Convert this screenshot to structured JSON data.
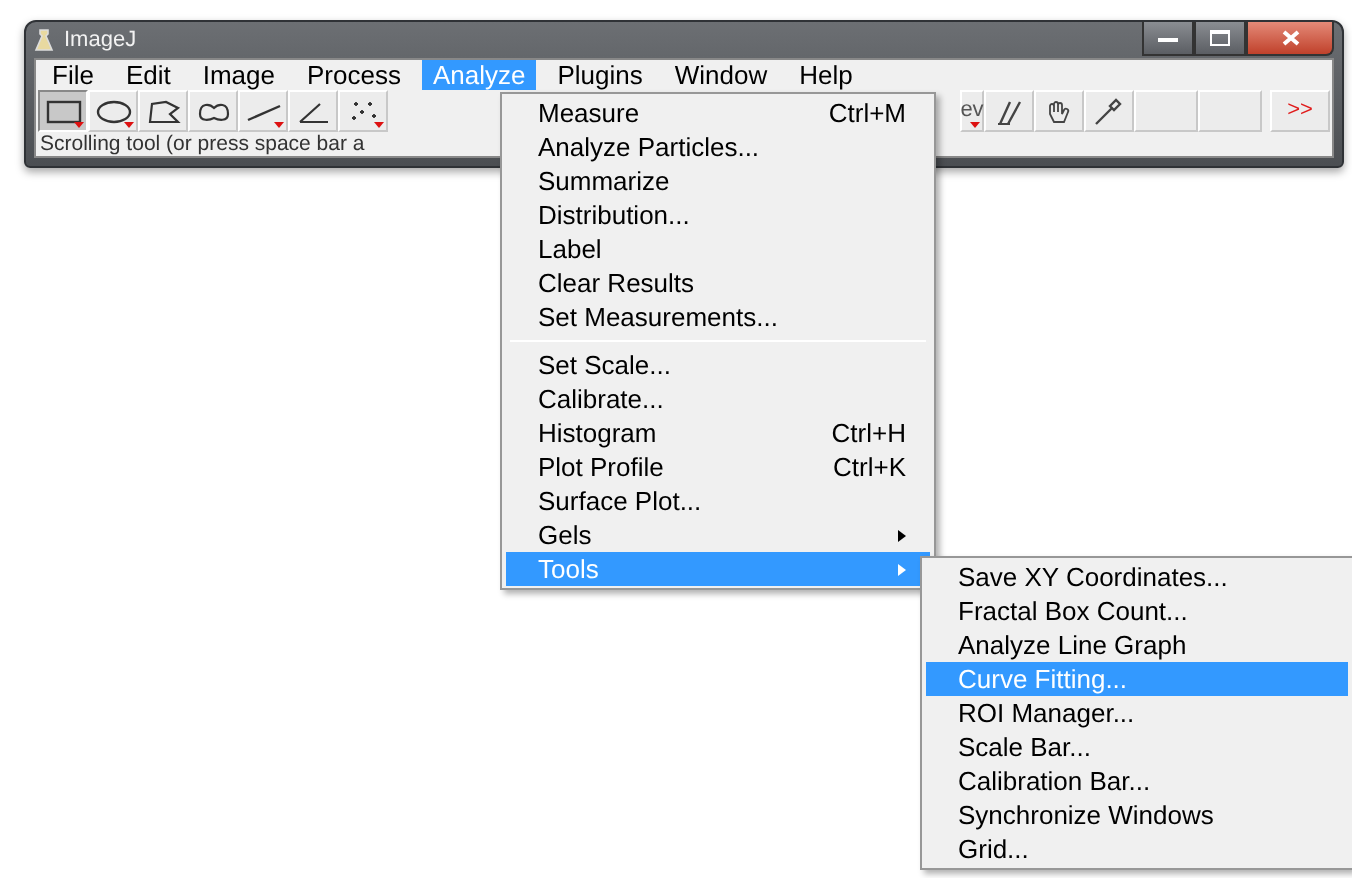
{
  "window": {
    "title": "ImageJ"
  },
  "menu_bar": [
    {
      "label": "File",
      "selected": false
    },
    {
      "label": "Edit",
      "selected": false
    },
    {
      "label": "Image",
      "selected": false
    },
    {
      "label": "Process",
      "selected": false
    },
    {
      "label": "Analyze",
      "selected": true
    },
    {
      "label": "Plugins",
      "selected": false
    },
    {
      "label": "Window",
      "selected": false
    },
    {
      "label": "Help",
      "selected": false
    }
  ],
  "toolbar": [
    {
      "kind": "rectangle",
      "selected": true,
      "has_menu": true
    },
    {
      "kind": "oval",
      "selected": false,
      "has_menu": true
    },
    {
      "kind": "polygon",
      "selected": false,
      "has_menu": false
    },
    {
      "kind": "freehand",
      "selected": false,
      "has_menu": false
    },
    {
      "kind": "line",
      "selected": false,
      "has_menu": true
    },
    {
      "kind": "angle",
      "selected": false,
      "has_menu": false
    },
    {
      "kind": "points",
      "selected": false,
      "has_menu": true
    },
    {
      "kind": "gap"
    },
    {
      "kind": "text",
      "label": "ev",
      "selected": false,
      "has_menu": true
    },
    {
      "kind": "brush",
      "selected": false,
      "has_menu": false
    },
    {
      "kind": "hand",
      "selected": false,
      "has_menu": false
    },
    {
      "kind": "dropper",
      "selected": false,
      "has_menu": false
    },
    {
      "kind": "empty",
      "selected": false,
      "has_menu": false
    },
    {
      "kind": "empty",
      "selected": false,
      "has_menu": false
    },
    {
      "kind": "more",
      "label": ">>",
      "selected": false,
      "has_menu": false
    }
  ],
  "status_text": "Scrolling tool (or press space bar a",
  "analyze_menu": [
    {
      "kind": "item",
      "label": "Measure",
      "shortcut": "Ctrl+M",
      "submenu": false,
      "selected": false
    },
    {
      "kind": "item",
      "label": "Analyze Particles...",
      "submenu": false,
      "selected": false
    },
    {
      "kind": "item",
      "label": "Summarize",
      "submenu": false,
      "selected": false
    },
    {
      "kind": "item",
      "label": "Distribution...",
      "submenu": false,
      "selected": false
    },
    {
      "kind": "item",
      "label": "Label",
      "submenu": false,
      "selected": false
    },
    {
      "kind": "item",
      "label": "Clear Results",
      "submenu": false,
      "selected": false
    },
    {
      "kind": "item",
      "label": "Set Measurements...",
      "submenu": false,
      "selected": false
    },
    {
      "kind": "separator"
    },
    {
      "kind": "item",
      "label": "Set Scale...",
      "submenu": false,
      "selected": false
    },
    {
      "kind": "item",
      "label": "Calibrate...",
      "submenu": false,
      "selected": false
    },
    {
      "kind": "item",
      "label": "Histogram",
      "shortcut": "Ctrl+H",
      "submenu": false,
      "selected": false
    },
    {
      "kind": "item",
      "label": "Plot Profile",
      "shortcut": "Ctrl+K",
      "submenu": false,
      "selected": false
    },
    {
      "kind": "item",
      "label": "Surface Plot...",
      "submenu": false,
      "selected": false
    },
    {
      "kind": "item",
      "label": "Gels",
      "submenu": true,
      "selected": false
    },
    {
      "kind": "item",
      "label": "Tools",
      "submenu": true,
      "selected": true
    }
  ],
  "tools_submenu": [
    {
      "kind": "item",
      "label": "Save XY Coordinates...",
      "selected": false
    },
    {
      "kind": "item",
      "label": "Fractal Box Count...",
      "selected": false
    },
    {
      "kind": "item",
      "label": "Analyze Line Graph",
      "selected": false
    },
    {
      "kind": "item",
      "label": "Curve Fitting...",
      "selected": true
    },
    {
      "kind": "item",
      "label": "ROI Manager...",
      "selected": false
    },
    {
      "kind": "item",
      "label": "Scale Bar...",
      "selected": false
    },
    {
      "kind": "item",
      "label": "Calibration Bar...",
      "selected": false
    },
    {
      "kind": "item",
      "label": "Synchronize Windows",
      "selected": false
    },
    {
      "kind": "item",
      "label": "Grid...",
      "selected": false
    }
  ]
}
